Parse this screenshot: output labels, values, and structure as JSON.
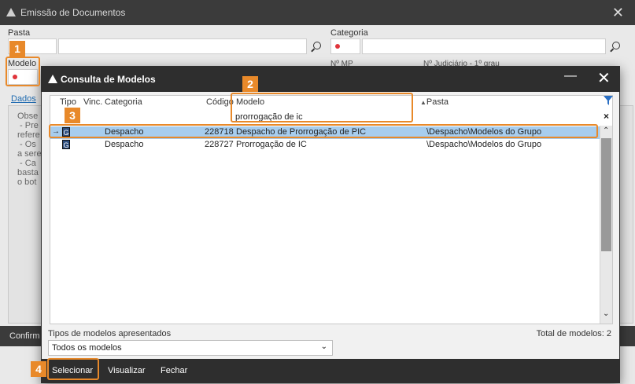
{
  "background": {
    "title": "Emissão de Documentos",
    "pasta_label": "Pasta",
    "categoria_label": "Categoria",
    "modelo_label": "Modelo",
    "n_mp": "Nº MP",
    "n_judiciario": "Nº Judiciário - 1º grau",
    "tab": "Dados",
    "desc_lines": "Obse\n - Pre\nrefere\n - Os\na sere\n - Ca\nbasta\no bot",
    "confirm": "Confirm"
  },
  "modal": {
    "title": "Consulta de Modelos",
    "columns": {
      "tipo": "Tipo",
      "vinc": "Vinc.",
      "categoria": "Categoria",
      "codigo": "Código",
      "modelo": "Modelo",
      "pasta": "Pasta"
    },
    "filter_value": "prorrogação de ic",
    "rows": [
      {
        "tipo": "G",
        "categoria": "Despacho",
        "codigo": "228718",
        "modelo": "Despacho de Prorrogação de PIC",
        "pasta": "\\Despacho\\Modelos do Grupo"
      },
      {
        "tipo": "G",
        "categoria": "Despacho",
        "codigo": "228727",
        "modelo": "Prorrogação de IC",
        "pasta": "\\Despacho\\Modelos do Grupo"
      }
    ],
    "types_label": "Tipos de modelos apresentados",
    "types_value": "Todos os modelos",
    "total_label": "Total de modelos: 2",
    "buttons": {
      "select": "Selecionar",
      "view": "Visualizar",
      "close": "Fechar"
    }
  },
  "callouts": [
    "1",
    "2",
    "3",
    "4"
  ],
  "colors": {
    "accent": "#e8892a",
    "selected_row": "#a7cdee",
    "titlebar": "#2e2e2e"
  }
}
